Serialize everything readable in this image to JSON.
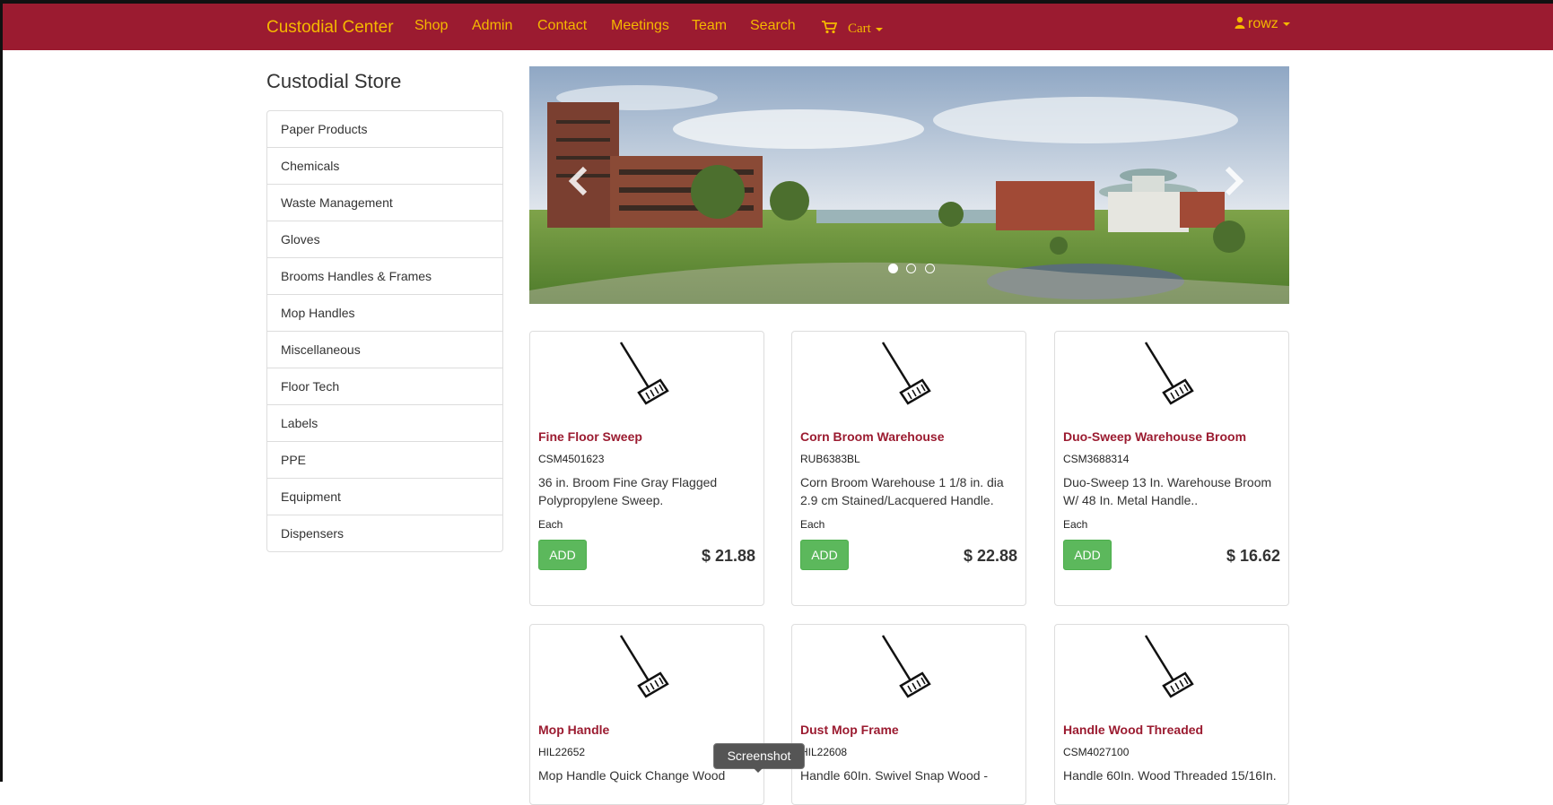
{
  "navbar": {
    "brand": "Custodial Center",
    "links": [
      "Shop",
      "Admin",
      "Contact",
      "Meetings",
      "Team",
      "Search"
    ],
    "cart_label": "Cart",
    "user": "rowz"
  },
  "store_title": "Custodial Store",
  "sidebar": {
    "items": [
      "Paper Products",
      "Chemicals",
      "Waste Management",
      "Gloves",
      "Brooms Handles & Frames",
      "Mop Handles",
      "Miscellaneous",
      "Floor Tech",
      "Labels",
      "PPE",
      "Equipment",
      "Dispensers"
    ]
  },
  "carousel": {
    "slide_count": 3,
    "active_slide": 1,
    "image_icon": "campus-photo"
  },
  "products": [
    {
      "name": "Fine Floor Sweep",
      "sku": "CSM4501623",
      "description": "36 in. Broom Fine Gray Flagged Polypropylene Sweep.",
      "unit": "Each",
      "add_label": "ADD",
      "price": "$ 21.88"
    },
    {
      "name": "Corn Broom Warehouse",
      "sku": "RUB6383BL",
      "description": "Corn Broom Warehouse 1 1/8 in. dia 2.9 cm Stained/Lacquered Handle.",
      "unit": "Each",
      "add_label": "ADD",
      "price": "$ 22.88"
    },
    {
      "name": "Duo-Sweep Warehouse Broom",
      "sku": "CSM3688314",
      "description": "Duo-Sweep 13 In. Warehouse Broom W/ 48 In. Metal Handle..",
      "unit": "Each",
      "add_label": "ADD",
      "price": "$ 16.62"
    },
    {
      "name": "Mop Handle",
      "sku": "HIL22652",
      "description": "Mop Handle Quick Change Wood",
      "unit": "",
      "add_label": "",
      "price": ""
    },
    {
      "name": "Dust Mop Frame",
      "sku": "HIL22608",
      "description": "Handle 60In. Swivel Snap Wood -",
      "unit": "",
      "add_label": "",
      "price": ""
    },
    {
      "name": "Handle Wood Threaded",
      "sku": "CSM4027100",
      "description": "Handle 60In. Wood Threaded 15/16In.",
      "unit": "",
      "add_label": "",
      "price": ""
    }
  ],
  "tooltip": "Screenshot",
  "colors": {
    "navbar_bg": "#9b1b30",
    "nav_text": "#f5b800",
    "product_name": "#9b1b30",
    "add_button": "#5cb85c"
  }
}
